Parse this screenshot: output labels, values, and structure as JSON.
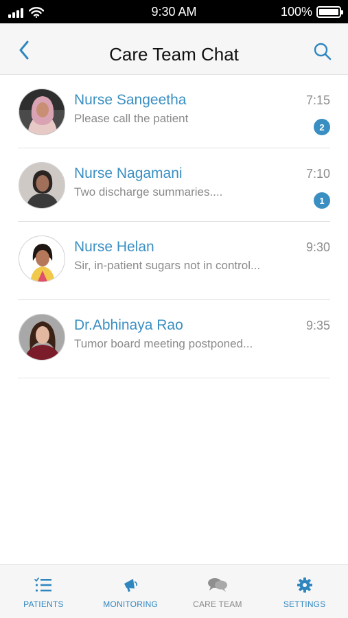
{
  "status_bar": {
    "time": "9:30 AM",
    "battery": "100%"
  },
  "nav": {
    "title": "Care Team Chat"
  },
  "chats": [
    {
      "name": "Nurse Sangeetha",
      "message": "Please call the patient",
      "time": "7:15",
      "badge": "2"
    },
    {
      "name": "Nurse Nagamani",
      "message": "Two discharge summaries....",
      "time": "7:10",
      "badge": "1"
    },
    {
      "name": "Nurse Helan",
      "message": "Sir, in-patient sugars not in control...",
      "time": "9:30"
    },
    {
      "name": "Dr.Abhinaya Rao",
      "message": "Tumor board meeting postponed...",
      "time": "9:35"
    }
  ],
  "tabs": [
    {
      "label": "PATIENTS",
      "icon": "list-icon",
      "active": true
    },
    {
      "label": "MONITORING",
      "icon": "megaphone-icon",
      "active": true
    },
    {
      "label": "CARE TEAM",
      "icon": "chat-bubbles-icon",
      "active": false
    },
    {
      "label": "SETTINGS",
      "icon": "gear-icon",
      "active": true
    }
  ],
  "colors": {
    "accent": "#3a8fc2",
    "muted": "#8a8a8a"
  }
}
